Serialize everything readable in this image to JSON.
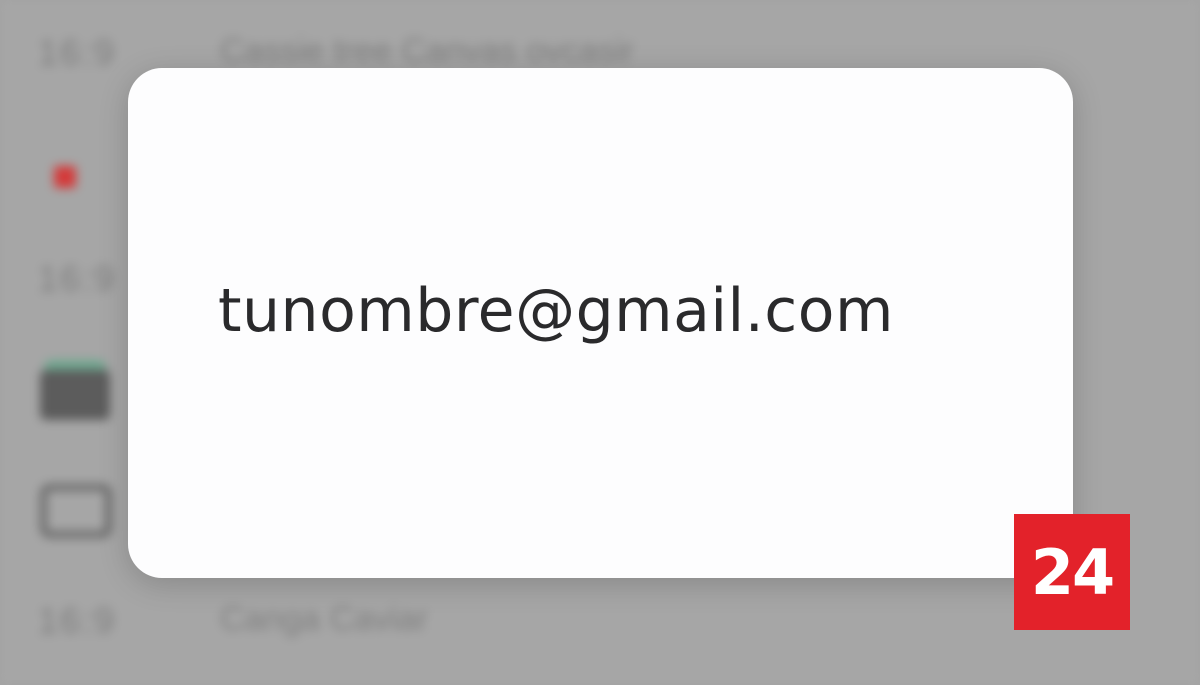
{
  "background": {
    "rows": [
      {
        "time": "16:9",
        "text": "Cassie tree Canvas ovcasir"
      },
      {
        "time": "16:9",
        "text": ""
      },
      {
        "time": "16:9",
        "text": "Canga Caviar"
      }
    ]
  },
  "dialog": {
    "email": "tunombre@gmail.com"
  },
  "logo": {
    "text": "24",
    "color": "#e3222a"
  }
}
